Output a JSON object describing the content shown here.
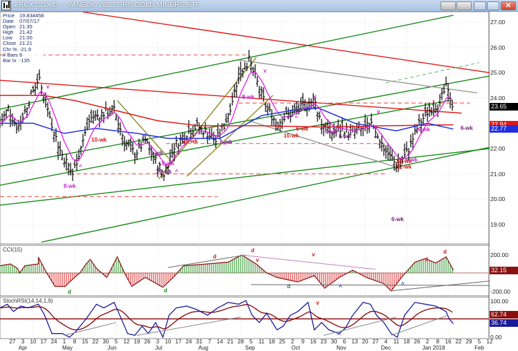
{
  "window": {
    "title": "ARCX:GDX.D -- VANECK VECTORS GOLD MINERS ETF"
  },
  "info": [
    {
      "k": "Price",
      "v": "19.834458"
    },
    {
      "k": "Date",
      "v": "07/07/17"
    },
    {
      "k": "Open",
      "v": "21.35"
    },
    {
      "k": "High",
      "v": "21.42"
    },
    {
      "k": "Low",
      "v": "21.00"
    },
    {
      "k": "Close",
      "v": "21.21"
    },
    {
      "k": "Chr %",
      "v": "-21.9"
    },
    {
      "k": "# Bars",
      "v": "6"
    },
    {
      "k": "Bar Ix",
      "v": "-135"
    }
  ],
  "chart_data": {
    "type": "ohlc",
    "title": "ARCX:GDX.D -- VANECK VECTORS GOLD MINERS ETF",
    "x_unit": "weeks since 2017-03-27",
    "ylim": [
      18.3,
      27.4
    ],
    "price_ticks": [
      "27.00",
      "26.00",
      "25.00",
      "24.00",
      "21.00",
      "20.00",
      "19.00",
      "22.00"
    ],
    "price_tick_values": [
      27,
      26,
      25,
      24,
      21,
      20,
      19,
      22
    ],
    "date_ticks": [
      "27",
      "3",
      "10",
      "17",
      "24",
      "1",
      "8",
      "15",
      "22",
      "30",
      "5",
      "12",
      "19",
      "26",
      "3",
      "10",
      "17",
      "24",
      "31",
      "7",
      "14",
      "21",
      "28",
      "5",
      "11",
      "18",
      "25",
      "2",
      "9",
      "16",
      "23",
      "30",
      "6",
      "13",
      "20",
      "27",
      "4",
      "11",
      "18",
      "26",
      "2",
      "8",
      "16",
      "22",
      "29",
      "5",
      "12"
    ],
    "month_ticks": [
      {
        "label": "Apr",
        "week": 1
      },
      {
        "label": "May",
        "week": 5.3
      },
      {
        "label": "Jun",
        "week": 9.6
      },
      {
        "label": "Jul",
        "week": 14.1
      },
      {
        "label": "Aug",
        "week": 18.4
      },
      {
        "label": "Sep",
        "week": 22.9
      },
      {
        "label": "Oct",
        "week": 27.3
      },
      {
        "label": "Nov",
        "week": 31.7
      },
      {
        "label": "Dec",
        "week": 36
      },
      {
        "label": "Jan 2018",
        "week": 40.6
      },
      {
        "label": "Feb",
        "week": 45
      }
    ],
    "close_path": [
      [
        -1.2,
        23.0
      ],
      [
        -0.4,
        23.6
      ],
      [
        0.5,
        22.8
      ],
      [
        1.5,
        23.8
      ],
      [
        2.5,
        24.8
      ],
      [
        3.5,
        23.4
      ],
      [
        4.5,
        22.0
      ],
      [
        5.8,
        21.0
      ],
      [
        6.7,
        22.2
      ],
      [
        7.5,
        23.2
      ],
      [
        8.8,
        23.4
      ],
      [
        9.8,
        23.5
      ],
      [
        10.8,
        22.3
      ],
      [
        11.8,
        21.8
      ],
      [
        12.8,
        22.3
      ],
      [
        13.8,
        21.5
      ],
      [
        14.6,
        21.0
      ],
      [
        15.6,
        22.1
      ],
      [
        16.7,
        22.6
      ],
      [
        17.8,
        22.9
      ],
      [
        18.8,
        22.6
      ],
      [
        19.6,
        22.3
      ],
      [
        20.5,
        23.0
      ],
      [
        21.1,
        23.8
      ],
      [
        21.8,
        24.9
      ],
      [
        22.8,
        25.5
      ],
      [
        23.6,
        24.6
      ],
      [
        24.5,
        23.6
      ],
      [
        25.5,
        23.0
      ],
      [
        26.5,
        23.3
      ],
      [
        27.5,
        23.5
      ],
      [
        28.1,
        23.7
      ],
      [
        29.1,
        23.9
      ],
      [
        29.8,
        23.0
      ],
      [
        30.8,
        22.6
      ],
      [
        31.8,
        22.8
      ],
      [
        32.8,
        22.6
      ],
      [
        33.8,
        22.8
      ],
      [
        34.8,
        22.9
      ],
      [
        35.8,
        22.0
      ],
      [
        37.1,
        21.3
      ],
      [
        38.1,
        21.9
      ],
      [
        39.1,
        22.9
      ],
      [
        40.1,
        23.5
      ],
      [
        41.1,
        23.8
      ],
      [
        41.8,
        24.4
      ],
      [
        42.5,
        23.65
      ]
    ],
    "ma_red": [
      [
        -1.2,
        24.1
      ],
      [
        3,
        24.1
      ],
      [
        6,
        23.9
      ],
      [
        10,
        23.5
      ],
      [
        14,
        23.1
      ],
      [
        18,
        22.9
      ],
      [
        24,
        22.9
      ],
      [
        30,
        22.85
      ],
      [
        36,
        22.9
      ],
      [
        42.5,
        22.94
      ]
    ],
    "ma_blue": [
      [
        -1.2,
        23.0
      ],
      [
        2,
        23.0
      ],
      [
        5,
        22.6
      ],
      [
        8,
        22.8
      ],
      [
        12,
        22.6
      ],
      [
        15,
        22.4
      ],
      [
        20,
        22.4
      ],
      [
        24,
        23.3
      ],
      [
        27.5,
        23.55
      ],
      [
        29.5,
        23.6
      ],
      [
        33,
        23.0
      ],
      [
        37,
        22.7
      ],
      [
        40,
        23.0
      ],
      [
        42.5,
        22.77
      ]
    ],
    "trendlines": [
      {
        "color": "#1a8a1a",
        "a": [
          -1.2,
          23.56
        ],
        "b": [
          42.5,
          27.27
        ]
      },
      {
        "color": "#1a8a1a",
        "a": [
          -1.2,
          21.3
        ],
        "b": [
          46,
          24.87
        ]
      },
      {
        "color": "#1a8a1a",
        "a": [
          -1.2,
          20.55
        ],
        "b": [
          42.1,
          23.9
        ]
      },
      {
        "color": "#1a8a1a",
        "a": [
          -1.2,
          19.76
        ],
        "b": [
          46,
          22.0
        ]
      },
      {
        "color": "#1a8a1a",
        "a": [
          2.8,
          18.3
        ],
        "b": [
          46,
          22.05
        ]
      },
      {
        "color": "#e01818",
        "a": [
          6.8,
          27.4
        ],
        "b": [
          46,
          25.0
        ]
      },
      {
        "color": "#e01818",
        "a": [
          -1.2,
          24.7
        ],
        "b": [
          43.3,
          23.4
        ]
      },
      {
        "color": "#999999",
        "a": [
          21.8,
          25.5
        ],
        "b": [
          44.8,
          24.2
        ]
      },
      {
        "color": "#999999",
        "a": [
          22.8,
          23.1
        ],
        "b": [
          37.5,
          21.2
        ]
      },
      {
        "color": "#8a8a20",
        "a": [
          14.1,
          20.8
        ],
        "b": [
          23.5,
          25.6
        ]
      },
      {
        "color": "#8a8a20",
        "a": [
          16.8,
          20.9
        ],
        "b": [
          25.1,
          24.1
        ]
      },
      {
        "color": "#8a8a20",
        "a": [
          10.1,
          23.9
        ],
        "b": [
          15.1,
          21.6
        ]
      }
    ],
    "dashed_levels": [
      {
        "price": 25.7,
        "from": -1.2,
        "to": 22.8
      },
      {
        "price": 23.8,
        "from": 21.8,
        "to": 44.1
      },
      {
        "price": 22.2,
        "from": 14.8,
        "to": 36.1
      },
      {
        "price": 21.0,
        "from": 5.5,
        "to": 36.1
      },
      {
        "price": 20.1,
        "from": -1.2,
        "to": 19.8
      }
    ],
    "annotations": [
      {
        "text": "8-wk",
        "color": "#d020d0"
      },
      {
        "text": "10-wk",
        "color": "#d01818"
      },
      {
        "text": "6-wk",
        "color": "#7a1a7a"
      },
      {
        "text": "8-wk",
        "color": "#d020d0"
      },
      {
        "text": "26-wk",
        "color": "#7a1a7a"
      },
      {
        "text": "20-wk",
        "color": "#d01818"
      },
      {
        "text": "6-wk",
        "color": "#7a1a7a"
      },
      {
        "text": "8-wk",
        "color": "#d020d0"
      },
      {
        "text": "10-wk",
        "color": "#d01818"
      },
      {
        "text": "6-wk",
        "color": "#d01818"
      },
      {
        "text": "8-wk",
        "color": "#d020d0"
      },
      {
        "text": "6-wk",
        "color": "#7a1a7a"
      },
      {
        "text": "20-wk",
        "color": "#d01818"
      },
      {
        "text": "52-wk",
        "color": "#d01818"
      },
      {
        "text": "6-wk",
        "color": "#d020d0"
      },
      {
        "text": "6-wk",
        "color": "#d020d0"
      },
      {
        "text": "6-wk",
        "color": "#7a1a7a"
      },
      {
        "text": "6-wk",
        "color": "#7a1a7a"
      },
      {
        "text": "v",
        "color": "#d020d0"
      },
      {
        "text": "^",
        "color": "#d020d0"
      },
      {
        "text": "^",
        "color": "#d020d0"
      },
      {
        "text": "^",
        "color": "#d020d0"
      },
      {
        "text": "v",
        "color": "#d020d0"
      },
      {
        "text": "^",
        "color": "#d020d0"
      },
      {
        "text": "v",
        "color": "#d020d0"
      },
      {
        "text": "v",
        "color": "#d020d0"
      }
    ],
    "last_tags": {
      "price": "23.65",
      "ma_red": "22.94",
      "ma_blue": "22.77"
    },
    "cci": {
      "label": "CCI(15)",
      "ticks": [
        "200.00",
        "-200.00"
      ],
      "last": "32.15",
      "values": [
        [
          -1.2,
          80
        ],
        [
          -0.2,
          100
        ],
        [
          0.5,
          50
        ],
        [
          0.7,
          0
        ],
        [
          1.2,
          80
        ],
        [
          2.5,
          100
        ],
        [
          2.5,
          175
        ],
        [
          3.3,
          0
        ],
        [
          4.1,
          -150
        ],
        [
          5.1,
          -150
        ],
        [
          5.5,
          -100
        ],
        [
          6.5,
          0
        ],
        [
          7.1,
          100
        ],
        [
          7.5,
          150
        ],
        [
          8.1,
          50
        ],
        [
          9.1,
          -50
        ],
        [
          10.1,
          180
        ],
        [
          10.8,
          0
        ],
        [
          11.5,
          -150
        ],
        [
          12.8,
          -50
        ],
        [
          14.5,
          -160
        ],
        [
          15.5,
          -50
        ],
        [
          16.5,
          80
        ],
        [
          18.8,
          100
        ],
        [
          20.8,
          120
        ],
        [
          22.1,
          200
        ],
        [
          23.5,
          100
        ],
        [
          24.5,
          0
        ],
        [
          25.5,
          -50
        ],
        [
          27.5,
          -100
        ],
        [
          29.1,
          -30
        ],
        [
          30.1,
          -170
        ],
        [
          31.5,
          -50
        ],
        [
          32.8,
          30
        ],
        [
          34.1,
          -50
        ],
        [
          35.8,
          -120
        ],
        [
          36.5,
          -200
        ],
        [
          37.5,
          -50
        ],
        [
          38.8,
          120
        ],
        [
          39.8,
          160
        ],
        [
          40.8,
          110
        ],
        [
          41.8,
          180
        ],
        [
          42.5,
          32
        ]
      ],
      "markers": [
        {
          "text": "d",
          "color": "#1a8a1a"
        },
        {
          "text": "d",
          "color": "#1a8a1a"
        },
        {
          "text": "d",
          "color": "#d01818"
        },
        {
          "text": "d",
          "color": "#d01818"
        },
        {
          "text": "v",
          "color": "#d01818"
        },
        {
          "text": "v",
          "color": "#d01818"
        },
        {
          "text": "d",
          "color": "#1a8a1a"
        },
        {
          "text": "^",
          "color": "#1a3ad0"
        },
        {
          "text": "^",
          "color": "#1a3ad0"
        },
        {
          "text": "d",
          "color": "#d01818"
        },
        {
          "text": "d",
          "color": "#d01818"
        }
      ]
    },
    "stoch": {
      "label": "StochRSI(14,14,1,9)",
      "ticks": [
        "100.00",
        "0.00"
      ],
      "last_slow": "62.74",
      "last_fast": "36.74",
      "fast": [
        [
          -1.2,
          80
        ],
        [
          -0.5,
          90
        ],
        [
          0.1,
          70
        ],
        [
          0.8,
          85
        ],
        [
          1.5,
          80
        ],
        [
          2.5,
          90
        ],
        [
          3.1,
          60
        ],
        [
          3.8,
          10
        ],
        [
          4.8,
          10
        ],
        [
          5.5,
          0
        ],
        [
          6.1,
          15
        ],
        [
          7.1,
          50
        ],
        [
          8.1,
          90
        ],
        [
          8.8,
          80
        ],
        [
          9.8,
          95
        ],
        [
          10.5,
          50
        ],
        [
          11.1,
          10
        ],
        [
          11.8,
          5
        ],
        [
          12.5,
          30
        ],
        [
          13.1,
          10
        ],
        [
          13.8,
          40
        ],
        [
          14.5,
          0
        ],
        [
          15.1,
          60
        ],
        [
          15.8,
          80
        ],
        [
          16.8,
          85
        ],
        [
          17.8,
          75
        ],
        [
          18.8,
          60
        ],
        [
          19.8,
          80
        ],
        [
          20.8,
          95
        ],
        [
          21.8,
          90
        ],
        [
          22.5,
          100
        ],
        [
          23.1,
          60
        ],
        [
          23.8,
          40
        ],
        [
          24.5,
          65
        ],
        [
          25.5,
          20
        ],
        [
          26.1,
          30
        ],
        [
          26.8,
          60
        ],
        [
          27.5,
          70
        ],
        [
          28.5,
          95
        ],
        [
          29.1,
          20
        ],
        [
          29.8,
          40
        ],
        [
          30.5,
          20
        ],
        [
          31.5,
          10
        ],
        [
          32.1,
          25
        ],
        [
          32.8,
          60
        ],
        [
          33.8,
          95
        ],
        [
          34.5,
          90
        ],
        [
          35.1,
          60
        ],
        [
          35.8,
          40
        ],
        [
          36.5,
          10
        ],
        [
          37.1,
          0
        ],
        [
          37.8,
          60
        ],
        [
          38.8,
          95
        ],
        [
          39.8,
          90
        ],
        [
          40.8,
          85
        ],
        [
          41.8,
          70
        ],
        [
          42.1,
          50
        ],
        [
          42.5,
          37
        ]
      ],
      "markers": [
        {
          "text": "v",
          "color": "#d01818"
        },
        {
          "text": "^",
          "color": "#1a3ad0"
        }
      ]
    },
    "colors": {
      "price_bars": "#000000",
      "ma_red": "#e01818",
      "ma_blue": "#2030e0",
      "ma_fast": "#e020e0",
      "cci_up": "#1a8a1a",
      "cci_down": "#e01818",
      "stoch_fast": "#1a1a9a",
      "stoch_slow": "#8b1010"
    }
  }
}
